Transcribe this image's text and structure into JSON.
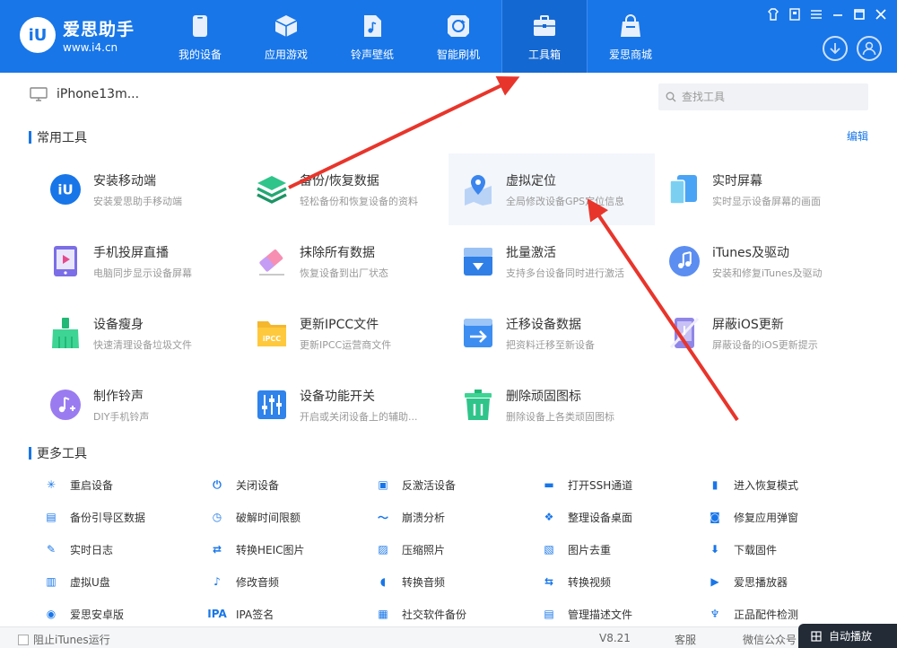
{
  "header": {
    "logo_badge": "iU",
    "logo_name": "爱思助手",
    "logo_url": "www.i4.cn",
    "nav": [
      {
        "label": "我的设备",
        "icon": "phone-icon"
      },
      {
        "label": "应用游戏",
        "icon": "cube-icon"
      },
      {
        "label": "铃声壁纸",
        "icon": "music-file-icon"
      },
      {
        "label": "智能刷机",
        "icon": "refresh-icon"
      },
      {
        "label": "工具箱",
        "icon": "toolbox-icon",
        "active": true
      },
      {
        "label": "爱思商城",
        "icon": "shopping-bag-icon"
      }
    ]
  },
  "device": {
    "name": "iPhone13m..."
  },
  "search": {
    "placeholder": "查找工具"
  },
  "common_tools": {
    "title": "常用工具",
    "edit_label": "编辑",
    "items": [
      {
        "title": "安装移动端",
        "desc": "安装爱思助手移动端",
        "icon": "i4-app-icon"
      },
      {
        "title": "备份/恢复数据",
        "desc": "轻松备份和恢复设备的资料",
        "icon": "layers-icon"
      },
      {
        "title": "虚拟定位",
        "desc": "全局修改设备GPS定位信息",
        "icon": "location-pin-icon"
      },
      {
        "title": "实时屏幕",
        "desc": "实时显示设备屏幕的画面",
        "icon": "screen-mirror-icon"
      },
      {
        "title": "手机投屏直播",
        "desc": "电脑同步显示设备屏幕",
        "icon": "screen-cast-icon"
      },
      {
        "title": "抹除所有数据",
        "desc": "恢复设备到出厂状态",
        "icon": "eraser-icon"
      },
      {
        "title": "批量激活",
        "desc": "支持多台设备同时进行激活",
        "icon": "batch-activate-icon"
      },
      {
        "title": "iTunes及驱动",
        "desc": "安装和修复iTunes及驱动",
        "icon": "itunes-icon"
      },
      {
        "title": "设备瘦身",
        "desc": "快速清理设备垃圾文件",
        "icon": "broom-icon"
      },
      {
        "title": "更新IPCC文件",
        "desc": "更新IPCC运营商文件",
        "icon": "ipcc-folder-icon"
      },
      {
        "title": "迁移设备数据",
        "desc": "把资料迁移至新设备",
        "icon": "migrate-icon"
      },
      {
        "title": "屏蔽iOS更新",
        "desc": "屏蔽设备的iOS更新提示",
        "icon": "block-update-icon"
      },
      {
        "title": "制作铃声",
        "desc": "DIY手机铃声",
        "icon": "ringtone-icon"
      },
      {
        "title": "设备功能开关",
        "desc": "开启或关闭设备上的辅助...",
        "icon": "switches-icon"
      },
      {
        "title": "删除顽固图标",
        "desc": "删除设备上各类顽固图标",
        "icon": "trash-icon"
      }
    ]
  },
  "more_tools": {
    "title": "更多工具",
    "items": [
      {
        "label": "重启设备",
        "icon": "restart-icon",
        "glyph": "✳"
      },
      {
        "label": "关闭设备",
        "icon": "power-icon",
        "glyph": "⏻"
      },
      {
        "label": "反激活设备",
        "icon": "deactivate-icon",
        "glyph": "▣"
      },
      {
        "label": "打开SSH通道",
        "icon": "ssh-icon",
        "glyph": "▬"
      },
      {
        "label": "进入恢复模式",
        "icon": "recovery-icon",
        "glyph": "▮"
      },
      {
        "label": "备份引导区数据",
        "icon": "backup-boot-icon",
        "glyph": "▤"
      },
      {
        "label": "破解时间限额",
        "icon": "clock-icon",
        "glyph": "◷"
      },
      {
        "label": "崩溃分析",
        "icon": "crash-icon",
        "glyph": "〜"
      },
      {
        "label": "整理设备桌面",
        "icon": "grid-icon",
        "glyph": "❖"
      },
      {
        "label": "修复应用弹窗",
        "icon": "fix-popup-icon",
        "glyph": "◙"
      },
      {
        "label": "实时日志",
        "icon": "log-icon",
        "glyph": "✎"
      },
      {
        "label": "转换HEIC图片",
        "icon": "heic-icon",
        "glyph": "⇄"
      },
      {
        "label": "压缩照片",
        "icon": "photo-icon",
        "glyph": "▨"
      },
      {
        "label": "图片去重",
        "icon": "dedupe-icon",
        "glyph": "▧"
      },
      {
        "label": "下载固件",
        "icon": "firmware-icon",
        "glyph": "⬇"
      },
      {
        "label": "虚拟U盘",
        "icon": "usb-icon",
        "glyph": "▥"
      },
      {
        "label": "修改音频",
        "icon": "audio-edit-icon",
        "glyph": "♪"
      },
      {
        "label": "转换音频",
        "icon": "audio-convert-icon",
        "glyph": "◖"
      },
      {
        "label": "转换视频",
        "icon": "video-convert-icon",
        "glyph": "⇆"
      },
      {
        "label": "爱思播放器",
        "icon": "player-icon",
        "glyph": "▶"
      },
      {
        "label": "爱思安卓版",
        "icon": "android-icon",
        "glyph": "◉"
      },
      {
        "label": "IPA签名",
        "icon": "ipa-icon",
        "glyph": "IPA"
      },
      {
        "label": "社交软件备份",
        "icon": "social-backup-icon",
        "glyph": "▦"
      },
      {
        "label": "管理描述文件",
        "icon": "profile-icon",
        "glyph": "▤"
      },
      {
        "label": "正品配件检测",
        "icon": "accessory-icon",
        "glyph": "♆"
      }
    ]
  },
  "status": {
    "block_itunes": "阻止iTunes运行",
    "version": "V8.21",
    "service": "客服",
    "wechat": "微信公众号",
    "autoplay": "自动播放"
  },
  "colors": {
    "brand": "#1876e8",
    "annotation": "#e8352b"
  }
}
